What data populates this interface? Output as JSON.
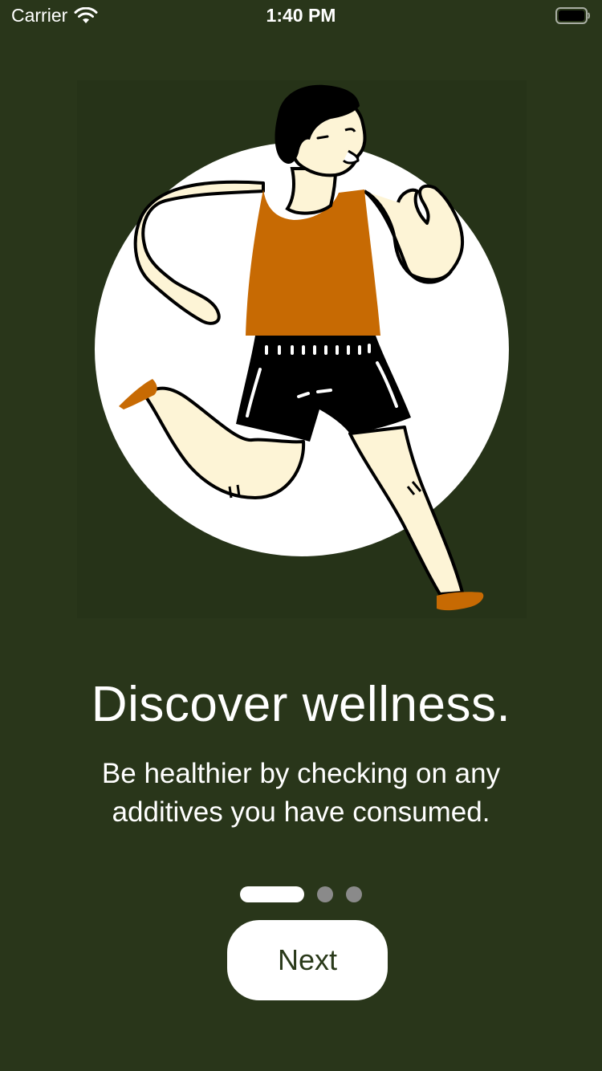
{
  "status_bar": {
    "carrier": "Carrier",
    "time": "1:40 PM"
  },
  "onboarding": {
    "title": "Discover wellness.",
    "subtitle": "Be healthier by checking on any additives you have consumed.",
    "page_count": 3,
    "current_page": 1,
    "next_label": "Next"
  },
  "colors": {
    "background": "#29361a",
    "button": "#ffffff",
    "accent_orange": "#c76a03",
    "inactive_dot": "#8a8a8a"
  }
}
